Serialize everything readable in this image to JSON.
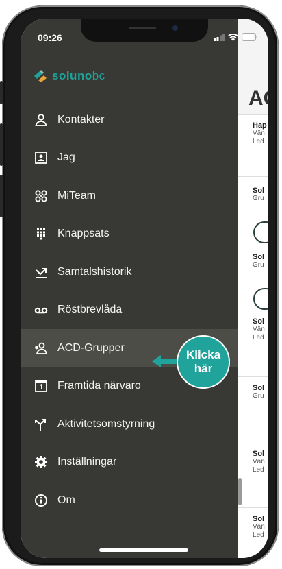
{
  "status": {
    "time": "09:26"
  },
  "logo": {
    "brand": "soluno",
    "suffix": "bc"
  },
  "menu": [
    {
      "label": "Kontakter",
      "icon": "person-icon"
    },
    {
      "label": "Jag",
      "icon": "id-card-icon"
    },
    {
      "label": "MiTeam",
      "icon": "team-icon"
    },
    {
      "label": "Knappsats",
      "icon": "keypad-icon"
    },
    {
      "label": "Samtalshistorik",
      "icon": "call-history-icon"
    },
    {
      "label": "Röstbrevlåda",
      "icon": "voicemail-icon"
    },
    {
      "label": "ACD-Grupper",
      "icon": "acd-group-icon",
      "active": true
    },
    {
      "label": "Framtida närvaro",
      "icon": "calendar-icon"
    },
    {
      "label": "Aktivitetsomstyrning",
      "icon": "redirect-icon"
    },
    {
      "label": "Inställningar",
      "icon": "gear-icon"
    },
    {
      "label": "Om",
      "icon": "info-icon"
    }
  ],
  "callout": {
    "line1": "Klicka",
    "line2": "här"
  },
  "app": {
    "title": "AC",
    "items": [
      {
        "title": "Hap",
        "sub1": "Vän",
        "sub2": "Led"
      },
      {
        "title": "Sol",
        "sub1": "Gru"
      },
      {
        "title": "Sol",
        "sub1": "Gru"
      },
      {
        "title": "Sol",
        "sub1": "Vän",
        "sub2": "Led"
      },
      {
        "title": "Sol",
        "sub1": "Gru"
      },
      {
        "title": "Sol",
        "sub1": "Vän",
        "sub2": "Led"
      },
      {
        "title": "Sol",
        "sub1": "Vän",
        "sub2": "Led"
      }
    ]
  },
  "colors": {
    "accent": "#1fa39a",
    "drawer": "#383834",
    "active": "#4d4d48"
  }
}
